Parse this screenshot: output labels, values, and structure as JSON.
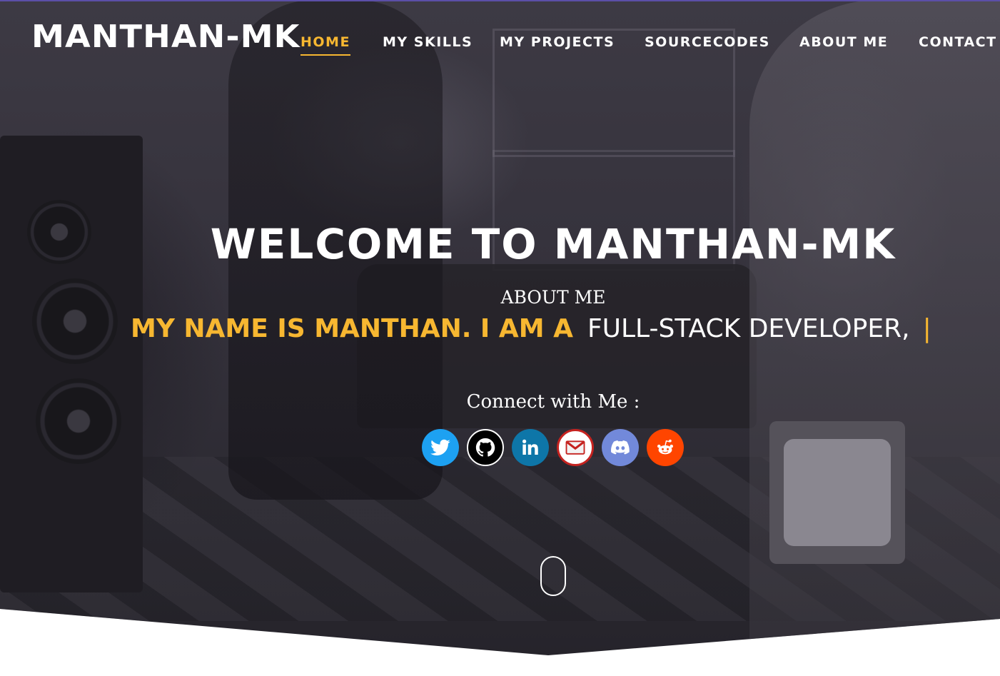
{
  "brand": {
    "logo": "MANTHAN-MK",
    "accent": "#f7b731"
  },
  "nav": {
    "items": [
      {
        "label": "HOME",
        "active": true
      },
      {
        "label": "MY SKILLS",
        "active": false
      },
      {
        "label": "MY PROJECTS",
        "active": false
      },
      {
        "label": "SOURCECODES",
        "active": false
      },
      {
        "label": "ABOUT ME",
        "active": false
      },
      {
        "label": "CONTACT",
        "active": false
      }
    ]
  },
  "hero": {
    "title": "WELCOME TO MANTHAN-MK",
    "section_label": "ABOUT ME",
    "tagline_static": "MY NAME IS MANTHAN. I AM A",
    "tagline_typed": "FULL-STACK DEVELOPER,",
    "cursor": "|",
    "connect_label": "Connect with Me :"
  },
  "socials": [
    {
      "name": "twitter",
      "icon": "twitter-icon",
      "color": "#1da1f2"
    },
    {
      "name": "github",
      "icon": "github-icon",
      "color": "#000000"
    },
    {
      "name": "linkedin",
      "icon": "linkedin-icon",
      "color": "#0e76a8"
    },
    {
      "name": "gmail",
      "icon": "mail-icon",
      "color": "#c5221f"
    },
    {
      "name": "discord",
      "icon": "discord-icon",
      "color": "#7289da"
    },
    {
      "name": "reddit",
      "icon": "reddit-icon",
      "color": "#ff4500"
    }
  ]
}
